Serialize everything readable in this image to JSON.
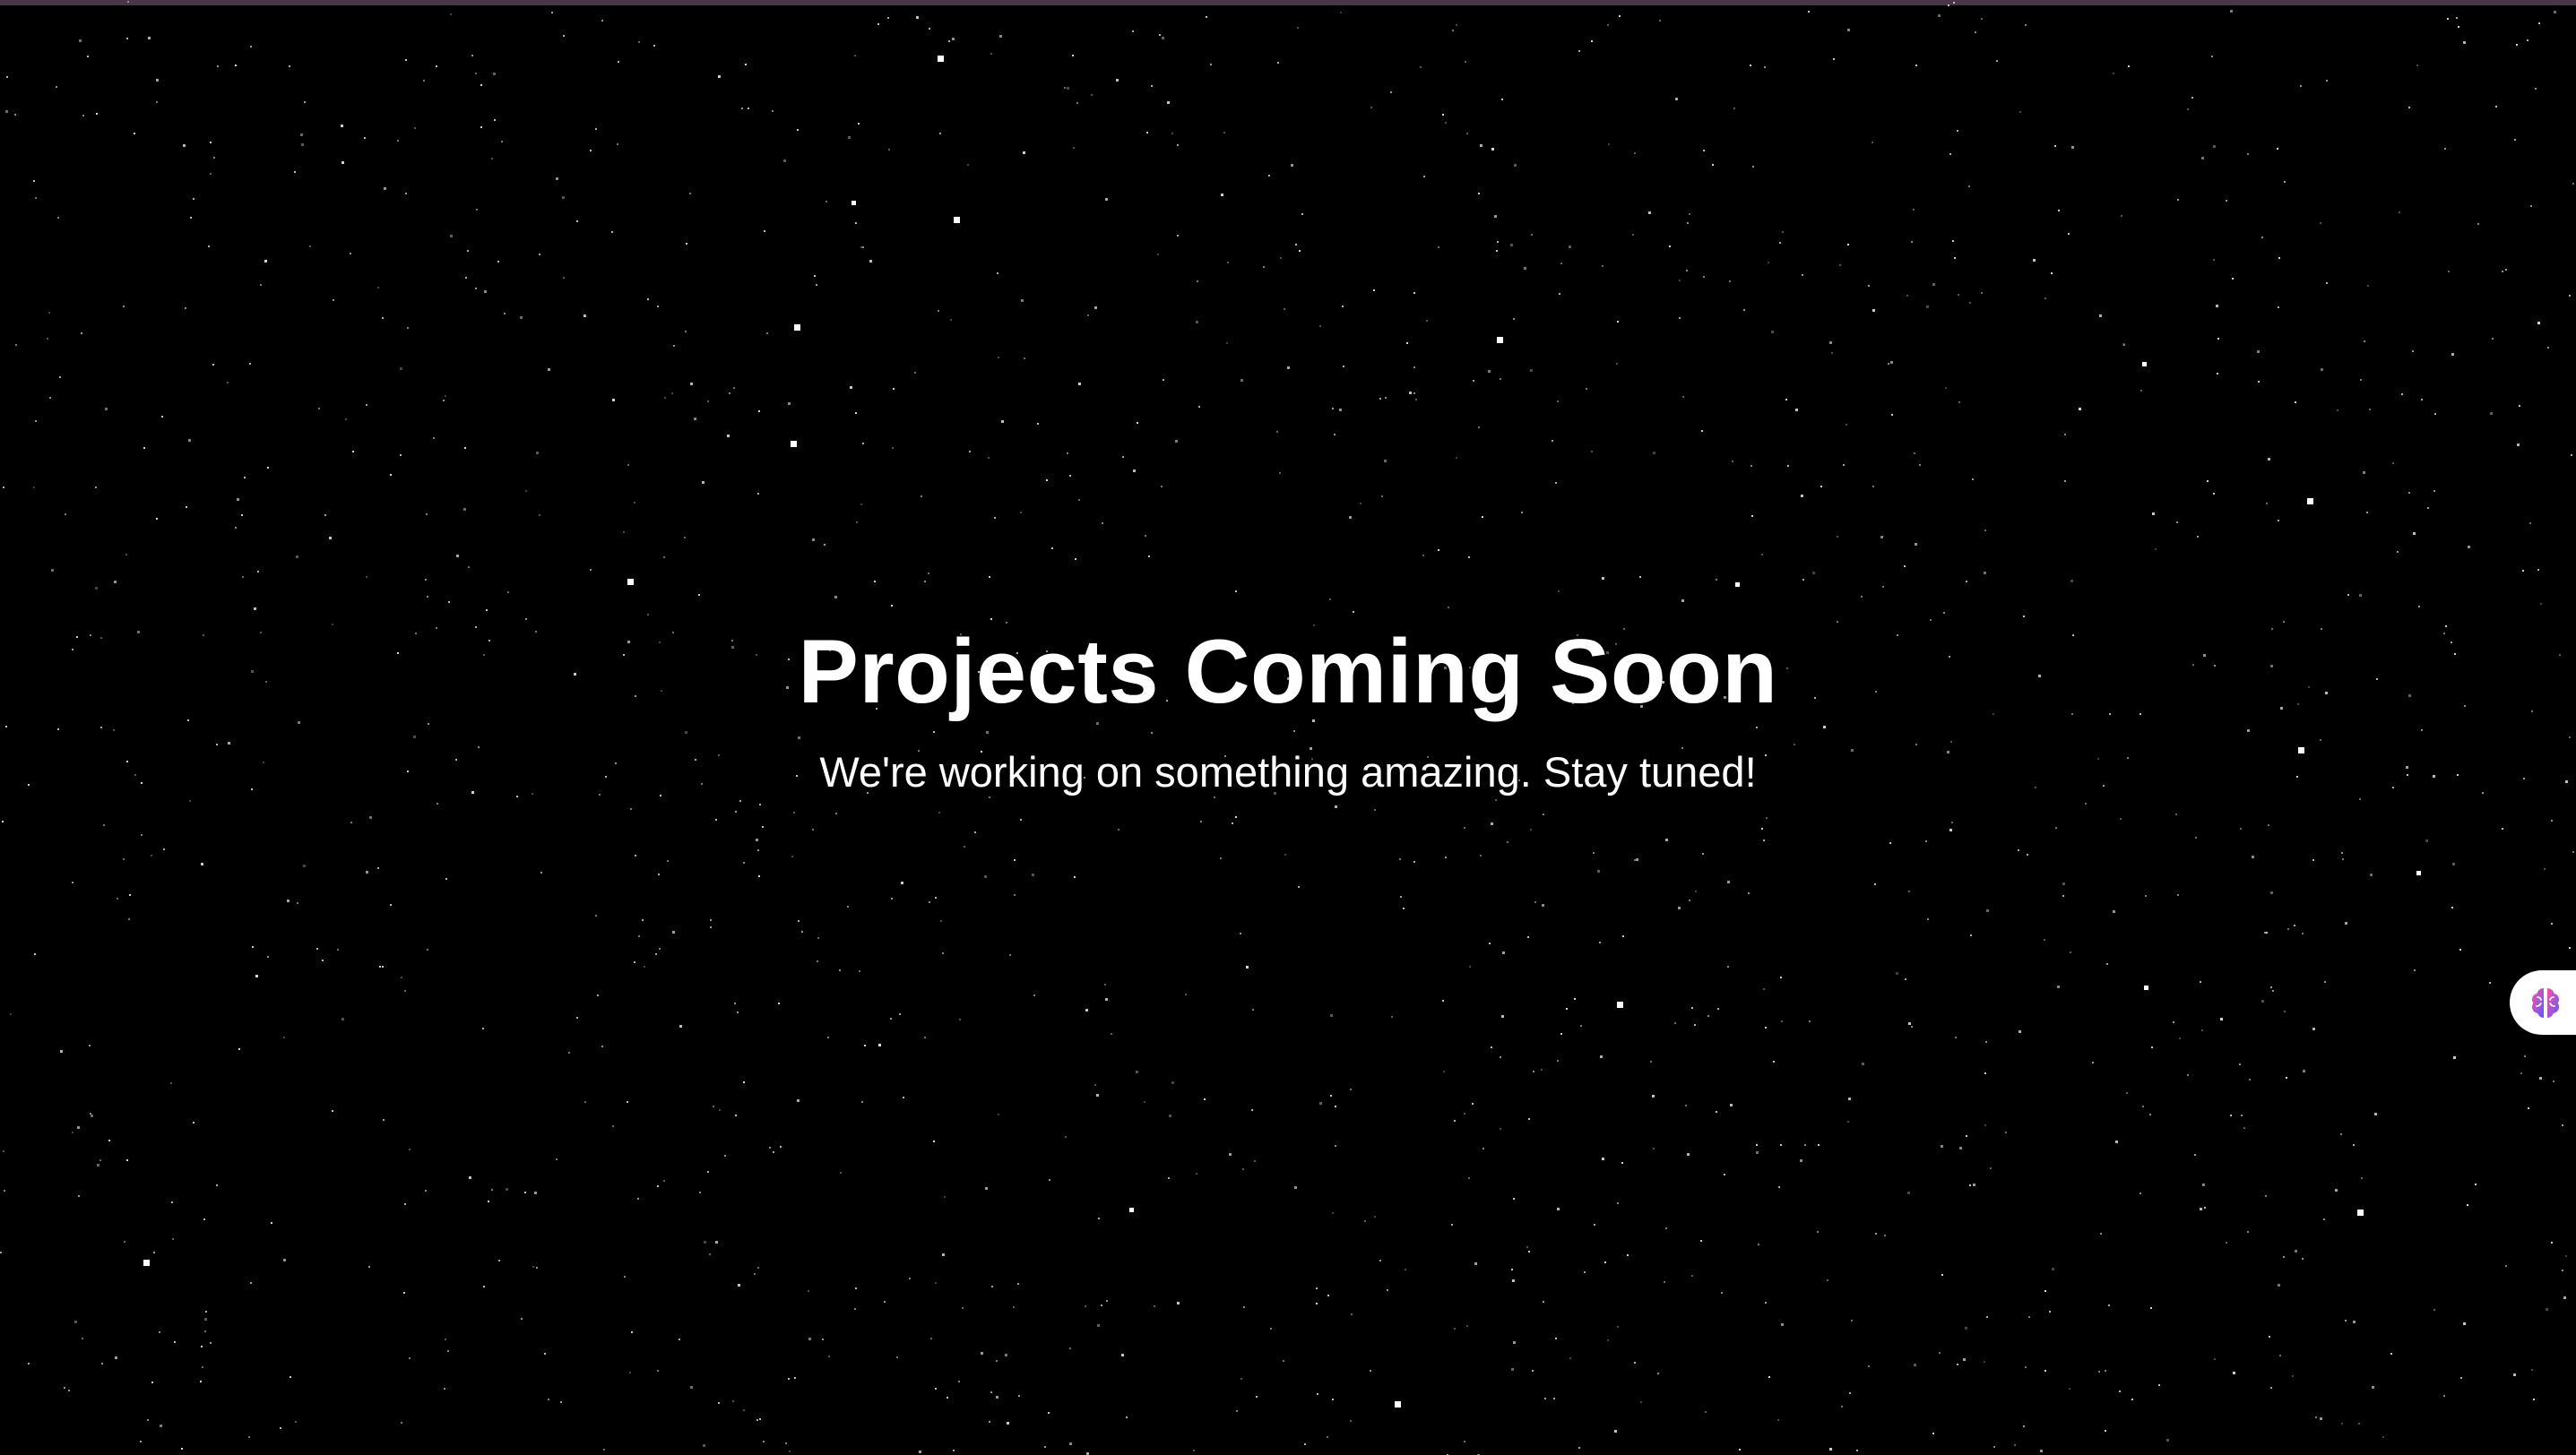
{
  "page": {
    "heading": "Projects Coming Soon",
    "subtitle": "We're working on something amazing. Stay tuned!"
  },
  "colors": {
    "background": "#000000",
    "text": "#ffffff",
    "top_bar": "#4a3646",
    "widget_gradient_start": "#ff4fa3",
    "widget_gradient_end": "#5b5cff"
  },
  "widget": {
    "icon": "brain-icon"
  }
}
